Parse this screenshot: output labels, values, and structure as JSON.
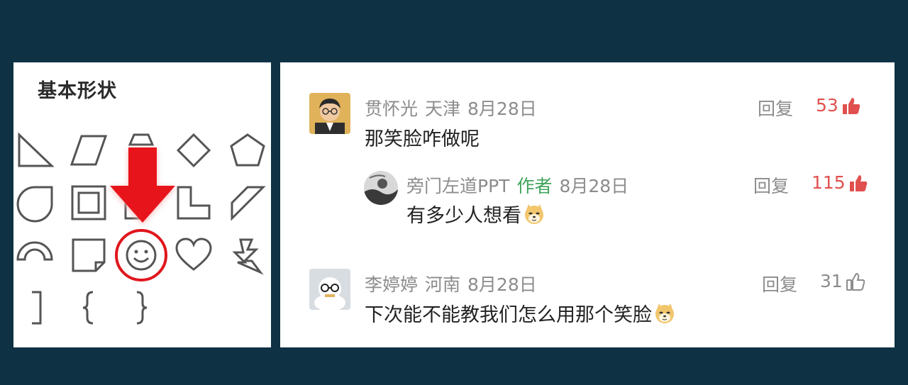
{
  "shapes_panel": {
    "title": "基本形状"
  },
  "comments": [
    {
      "username": "贯怀光",
      "location": "天津",
      "date": "8月28日",
      "reply_label": "回复",
      "likes": "53",
      "liked": true,
      "text": "那笑脸咋做呢"
    },
    {
      "username": "旁门左道PPT",
      "badge": "作者",
      "date": "8月28日",
      "reply_label": "回复",
      "likes": "115",
      "liked": true,
      "text": "有多少人想看"
    },
    {
      "username": "李婷婷",
      "location": "河南",
      "date": "8月28日",
      "reply_label": "回复",
      "likes": "31",
      "liked": false,
      "text": "下次能不能教我们怎么用那个笑脸"
    }
  ],
  "colors": {
    "background": "#0e3144",
    "like_active": "#e0504e",
    "author_badge": "#3fa45a",
    "highlight": "#e8141b"
  }
}
